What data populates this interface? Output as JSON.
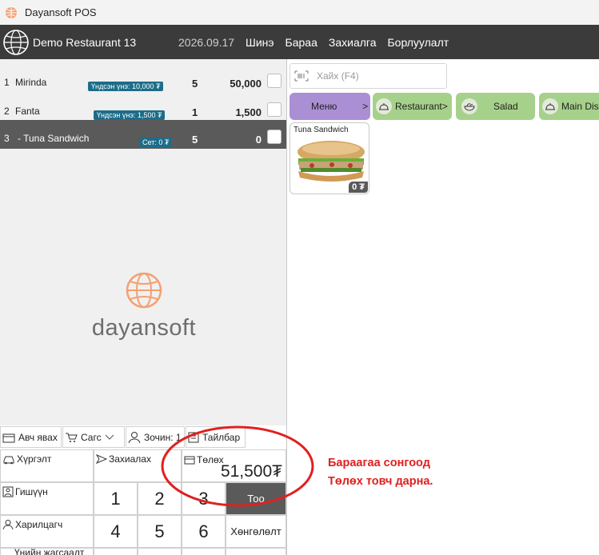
{
  "window": {
    "title": "Dayansoft POS"
  },
  "topbar": {
    "restaurant_name": "Demo Restaurant 13",
    "date": "2026.09.17",
    "nav": [
      "Шинэ",
      "Бараа",
      "Захиалга",
      "Борлуулалт"
    ]
  },
  "order_items": [
    {
      "index": "1",
      "name": "Mirinda",
      "price_badge": "Үндсэн үнэ: 10,000 ₮",
      "qty": "5",
      "total": "50,000"
    },
    {
      "index": "2",
      "name": "Fanta",
      "price_badge": "Үндсэн үнэ: 1,500 ₮",
      "qty": "1",
      "total": "1,500"
    },
    {
      "index": "3",
      "name": "- Tuna Sandwich",
      "price_badge": "Сет: 0 ₮",
      "qty": "5",
      "total": "0"
    }
  ],
  "brand": {
    "wordmark": "dayansoft"
  },
  "toolbar": {
    "takeaway": "Авч явах",
    "cart": "Сагс",
    "guests": "Зочин: 1",
    "report": "Тайлбар"
  },
  "panel": {
    "delivery": "Хүргэлт",
    "order": "Захиалах",
    "payment": "Төлөх",
    "payment_total": "51,500₮",
    "member": "Гишүүн",
    "customer": "Харилцагч",
    "bottom_cut": "Үнийн жагсаалт",
    "keys": [
      "1",
      "2",
      "3",
      "4",
      "5",
      "6"
    ],
    "fn_key": "Тоо",
    "discount": "Хөнгөлөлт"
  },
  "search": {
    "placeholder": "Хайх (F4)"
  },
  "categories": [
    {
      "label": "Меню",
      "arrow": ">",
      "color": "#ab8fd4"
    },
    {
      "label": "Restaurant>",
      "color": "#a6d18a"
    },
    {
      "label": "Salad",
      "color": "#a6d18a"
    },
    {
      "label": "Main Dis",
      "color": "#a6d18a"
    }
  ],
  "products": [
    {
      "name": "Tuna Sandwich",
      "price": "0 ₮"
    }
  ],
  "annotation": {
    "line1": "Бараагаа сонгоод",
    "line2": "Төлөх товч дарна.",
    "color": "#e02020"
  }
}
